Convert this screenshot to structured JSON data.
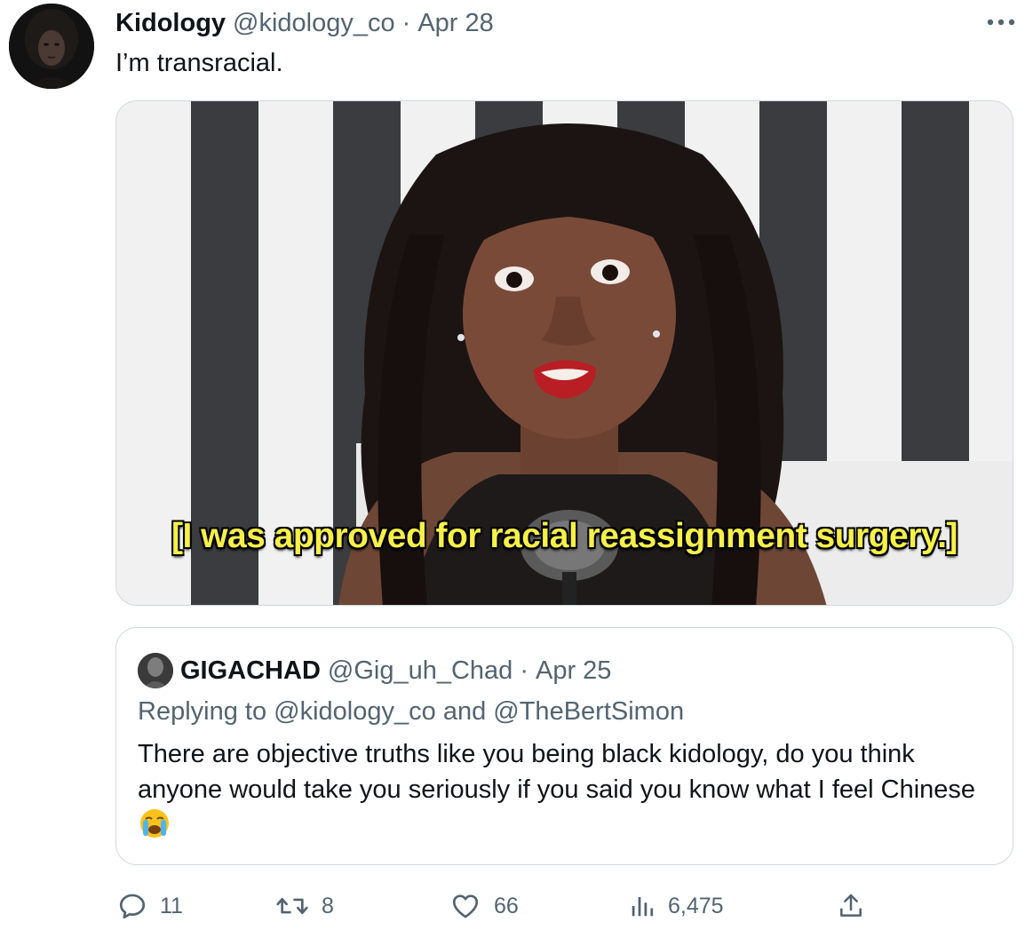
{
  "tweet": {
    "author": {
      "display_name": "Kidology",
      "handle": "@kidology_co"
    },
    "separator": "·",
    "date": "Apr 28",
    "text": "I’m transracial.",
    "media": {
      "caption": "[I was approved for racial reassignment surgery.]"
    },
    "quote": {
      "author": {
        "display_name": "GIGACHAD",
        "handle": "@Gig_uh_Chad"
      },
      "separator": "·",
      "date": "Apr 25",
      "replying_prefix": "Replying to",
      "replying_to": [
        "@kidology_co",
        "@TheBertSimon"
      ],
      "replying_and": "and",
      "text": "There are objective truths like you being black kidology, do you think anyone would take you seriously if you said you know what I feel Chinese",
      "emoji": "loudly-crying-face"
    },
    "metrics": {
      "replies": "11",
      "retweets": "8",
      "likes": "66",
      "views": "6,475"
    }
  },
  "colors": {
    "text_primary": "#0f1419",
    "text_secondary": "#536471",
    "border": "#cfd9de",
    "caption": "#f6f049"
  },
  "icons": [
    "more-icon",
    "reply-icon",
    "retweet-icon",
    "like-icon",
    "views-icon",
    "share-icon"
  ]
}
